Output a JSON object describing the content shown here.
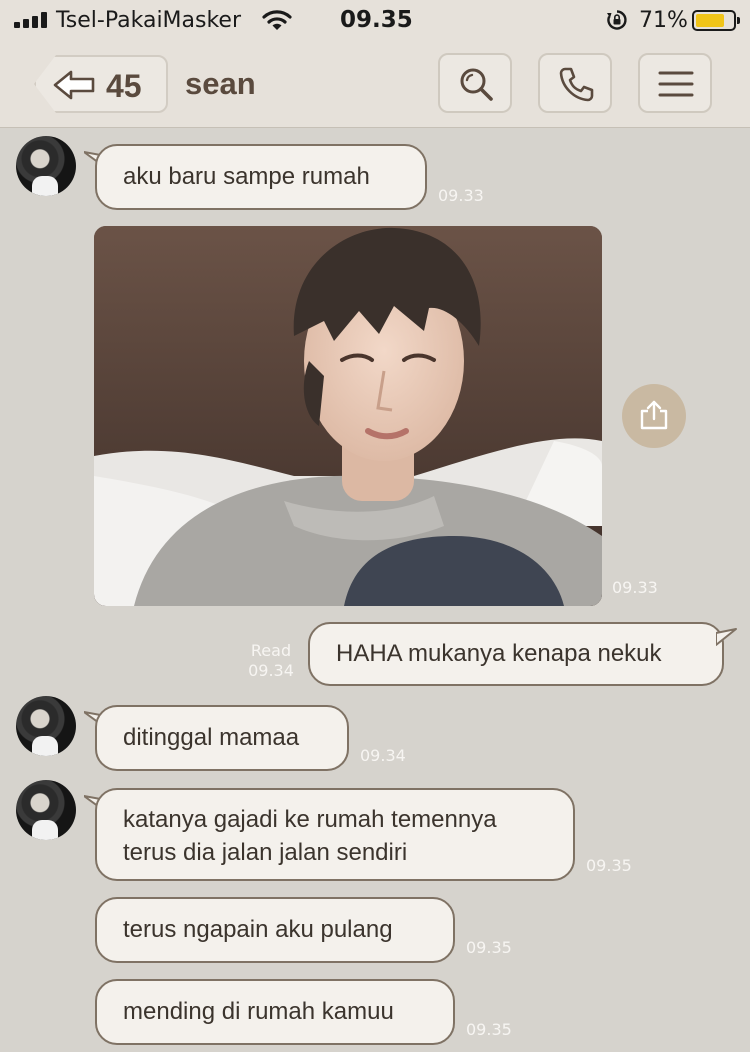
{
  "status_bar": {
    "carrier": "Tsel-PakaiMasker",
    "time": "09.35",
    "battery_percent": "71%",
    "battery_level": 0.71
  },
  "header": {
    "back_count": "45",
    "title": "sean"
  },
  "colors": {
    "background": "#d6d3cd",
    "header": "#e6e1da",
    "bubble_fill": "#f4f1ec",
    "bubble_border": "#7f7264",
    "share_button": "#c9b9a2",
    "battery": "#f0c419"
  },
  "messages": [
    {
      "side": "in",
      "text": "aku baru sampe rumah",
      "time": "09.33"
    },
    {
      "side": "in",
      "type": "image",
      "time": "09.33"
    },
    {
      "side": "out",
      "text": "HAHA mukanya kenapa nekuk",
      "status": "Read",
      "time": "09.34"
    },
    {
      "side": "in",
      "text": "ditinggal mamaa",
      "time": "09.34"
    },
    {
      "side": "in",
      "text": "katanya gajadi ke rumah temennya terus dia jalan jalan sendiri",
      "time": "09.35"
    },
    {
      "side": "in",
      "text": "terus ngapain aku pulang",
      "time": "09.35"
    },
    {
      "side": "in",
      "text": "mending di rumah kamuu",
      "time": "09.35"
    }
  ],
  "icons": {
    "back": "back-arrow-icon",
    "search": "search-icon",
    "call": "phone-icon",
    "menu": "menu-icon",
    "share": "share-icon"
  }
}
